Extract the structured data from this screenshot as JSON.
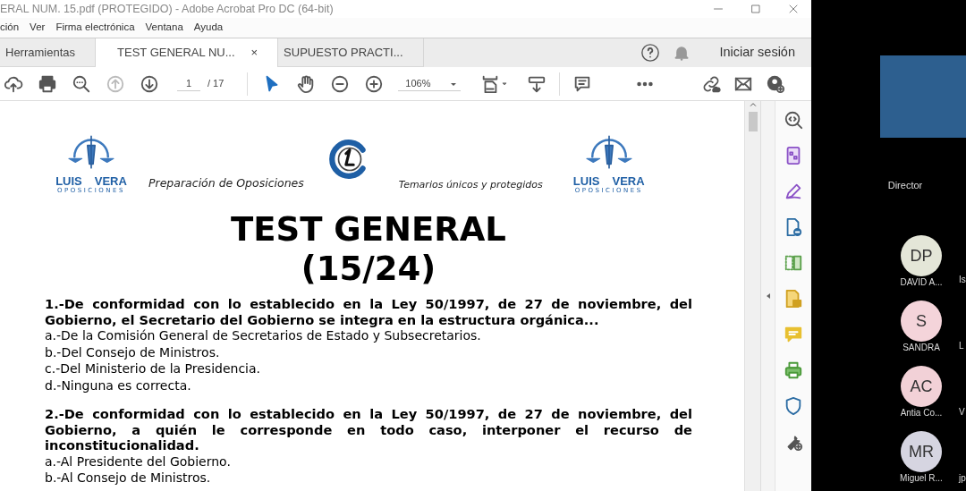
{
  "window": {
    "title": "ERAL NUM. 15.pdf (PROTEGIDO) - Adobe Acrobat Pro DC (64-bit)"
  },
  "menu": [
    "ción",
    "Ver",
    "Firma electrónica",
    "Ventana",
    "Ayuda"
  ],
  "tabs": [
    {
      "label": "Herramientas",
      "selected": false
    },
    {
      "label": "TEST GENERAL NU...",
      "selected": true,
      "close": "×"
    },
    {
      "label": "SUPUESTO PRACTI...",
      "selected": false
    }
  ],
  "account": {
    "label": "Iniciar sesión"
  },
  "toolbar": {
    "page": "1",
    "page_total": "/ 17",
    "zoom": "106%"
  },
  "document": {
    "header": {
      "logo_left": {
        "word1": "LUIS",
        "word2": "VERA",
        "subtitle": "OPOSICIONES"
      },
      "tagline_left": "Preparación de Oposiciones",
      "tagline_right": "Temarios únicos y protegidos",
      "logo_right": {
        "word1": "LUIS",
        "word2": "VERA",
        "subtitle": "OPOSICIONES"
      }
    },
    "title": "TEST GENERAL",
    "subtitle": "(15/24)",
    "questions": [
      {
        "text": "1.-De conformidad con lo establecido en la Ley 50/1997, de 27 de noviembre, del Gobierno, el Secretario del Gobierno se integra en la estructura orgánica...",
        "options": [
          "a.-De la Comisión General de Secretarios de Estado y Subsecretarios.",
          "b.-Del Consejo de Ministros.",
          "c.-Del Ministerio de la Presidencia.",
          "d.-Ninguna es correcta."
        ]
      },
      {
        "text": "2.-De conformidad con lo establecido en la Ley 50/1997, de 27 de noviembre, del Gobierno, a quién le corresponde en todo caso, interponer el recurso de inconstitucionalidad.",
        "options": [
          "a.-Al Presidente del Gobierno.",
          "b.-Al Consejo de Ministros."
        ]
      }
    ]
  },
  "meeting": {
    "speaker": {
      "name": "Director"
    },
    "participants": [
      {
        "initials": "DP",
        "name": "DAVID A...",
        "color": "#e4e6d8"
      },
      {
        "initials": "S",
        "name": "SANDRA",
        "color": "#f4d4da"
      },
      {
        "initials": "AC",
        "name": "Antia Co...",
        "color": "#f2d1d7"
      },
      {
        "initials": "MR",
        "name": "Miguel R...",
        "color": "#d6d5e1"
      }
    ],
    "next_column_names": [
      "Is",
      "L",
      "V",
      "jp"
    ]
  }
}
